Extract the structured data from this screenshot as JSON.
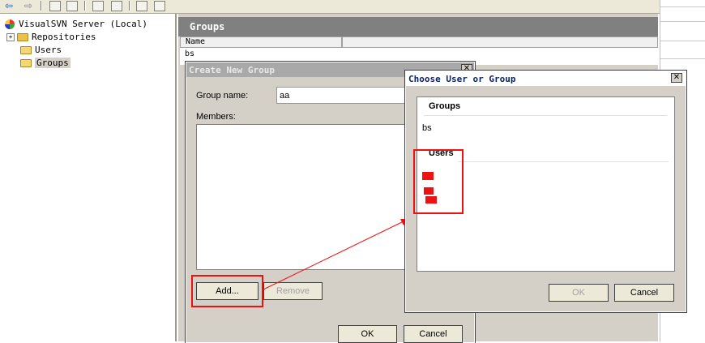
{
  "tree": {
    "root_label": "VisualSVN Server (Local)",
    "items": [
      {
        "label": "Repositories"
      },
      {
        "label": "Users"
      },
      {
        "label": "Groups"
      }
    ]
  },
  "panel": {
    "title": "Groups",
    "column_name": "Name",
    "first_row_partial": "bs"
  },
  "create_dialog": {
    "title": "Create New Group",
    "group_name_label": "Group name:",
    "group_name_value": "aa",
    "members_label": "Members:",
    "add_label": "Add...",
    "remove_label": "Remove",
    "ok_label": "OK",
    "cancel_label": "Cancel"
  },
  "choose_dialog": {
    "title": "Choose User or Group",
    "groups_header": "Groups",
    "groups": [
      "bs"
    ],
    "users_header": "Users",
    "ok_label": "OK",
    "cancel_label": "Cancel"
  },
  "colors": {
    "annotation": "#ee1111",
    "dialog_bg": "#d4d0c8"
  }
}
